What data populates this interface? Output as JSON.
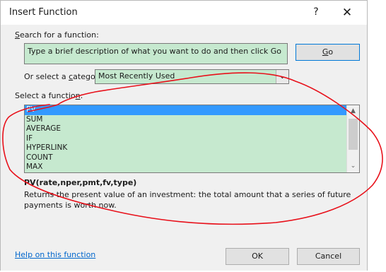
{
  "window": {
    "title": "Insert Function",
    "help_glyph": "?",
    "close_glyph": "✕"
  },
  "search": {
    "label_pre": "",
    "label_accel": "S",
    "label_post": "earch for a function:",
    "value": "Type a brief description of what you want to do and then click Go",
    "go_accel": "G",
    "go_post": "o"
  },
  "category": {
    "label_pre": "Or select a ",
    "label_accel": "c",
    "label_post": "ategory:",
    "selected": "Most Recently Used"
  },
  "function_list": {
    "label_pre": "Select a functio",
    "label_accel": "n",
    "label_post": ":",
    "items": [
      "PV",
      "SUM",
      "AVERAGE",
      "IF",
      "HYPERLINK",
      "COUNT",
      "MAX"
    ],
    "selected_index": 0
  },
  "details": {
    "syntax": "PV(rate,nper,pmt,fv,type)",
    "description": "Returns the present value of an investment: the total amount that a series of future payments is worth now."
  },
  "footer": {
    "help_link": "Help on this function",
    "ok": "OK",
    "cancel": "Cancel"
  },
  "annotation": {
    "color": "#e8101a",
    "shape": "hand-drawn-loop"
  },
  "colors": {
    "field_fill": "#c6e9cf",
    "selection": "#3399ff",
    "dialog_body": "#f0f0f0"
  }
}
